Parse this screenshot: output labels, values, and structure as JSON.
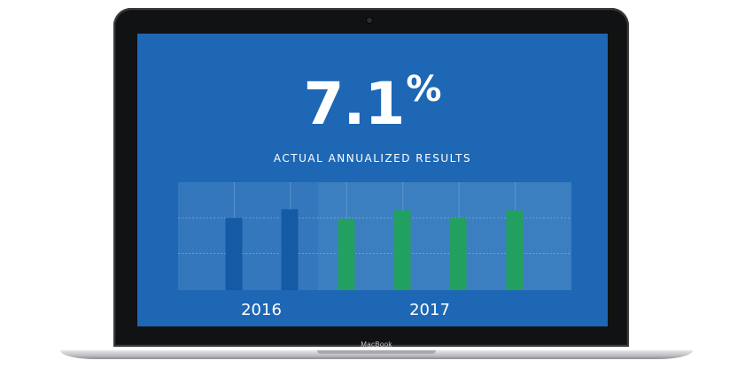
{
  "statistic": {
    "value": "7.1",
    "unit": "%",
    "caption": "ACTUAL ANNUALIZED RESULTS"
  },
  "device": {
    "brand": "MacBook"
  },
  "colors": {
    "screen_background": "#1e67b5",
    "plot_panel": "#3c7fc1",
    "bar_2016": "#145aa4",
    "bar_2017": "#22a05f",
    "text": "#ffffff"
  },
  "chart_data": {
    "type": "bar",
    "title": "",
    "xlabel": "",
    "ylabel": "",
    "grid": true,
    "ylim": [
      0,
      1
    ],
    "groups": [
      {
        "label": "2016",
        "values": [
          0.67,
          0.75
        ]
      },
      {
        "label": "2017",
        "values": [
          0.66,
          0.74,
          0.67,
          0.74
        ]
      }
    ]
  }
}
